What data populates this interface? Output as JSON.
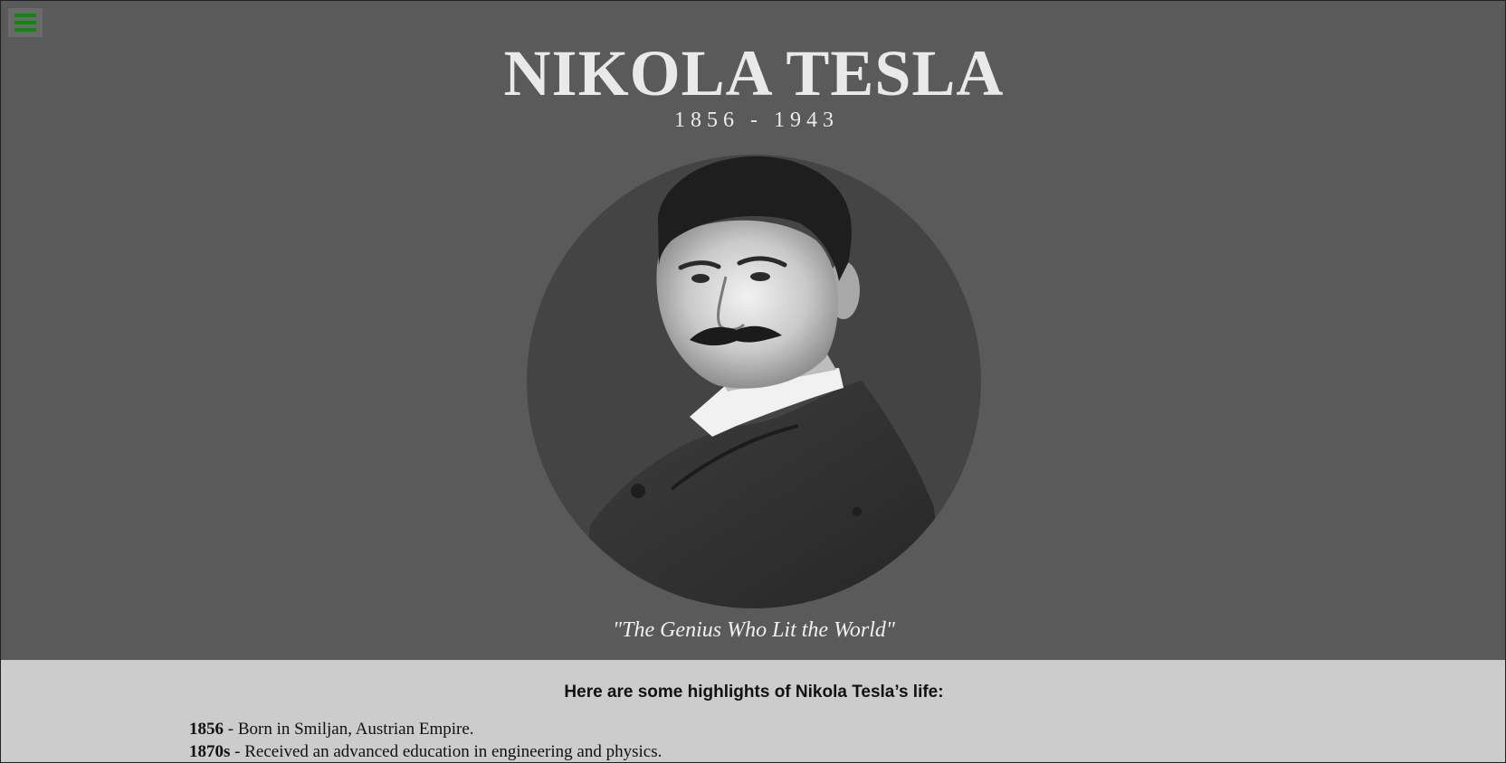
{
  "menu": {
    "icon": "hamburger-menu-icon",
    "color": "#0a8a0a"
  },
  "hero": {
    "title": "NIKOLA TESLA",
    "years": "1 8 5 6   -   1 9 4 3",
    "portrait_alt": "Portrait of Nikola Tesla",
    "quote": "\"The Genius Who Lit the World\"",
    "background": "#5a5a5a"
  },
  "content": {
    "heading": "Here are some highlights of Nikola Tesla’s life:",
    "background": "#cccccc",
    "timeline": [
      {
        "year": "1856",
        "sep": " - ",
        "text": "Born in Smiljan, Austrian Empire."
      },
      {
        "year": "1870s",
        "sep": " - ",
        "text": "Received an advanced education in engineering and physics."
      }
    ]
  }
}
